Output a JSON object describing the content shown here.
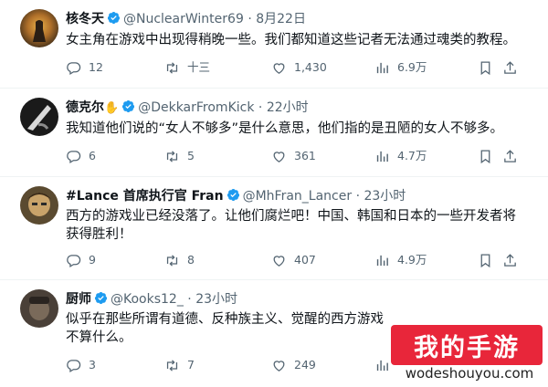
{
  "tweets": [
    {
      "name": "核冬天",
      "handle": "@NuclearWinter69",
      "sep": "·",
      "time": "8月22日",
      "text": "女主角在游戏中出现得稍晚一些。我们都知道这些记者无法通过魂类的教程。",
      "replies": "12",
      "retweets": "十三",
      "likes": "1,430",
      "views": "6.9万"
    },
    {
      "name": "德克尔",
      "handle": "@DekkarFromKick",
      "sep": "·",
      "time": "22小时",
      "text": "我知道他们说的“女人不够多”是什么意思，他们指的是丑陋的女人不够多。",
      "replies": "6",
      "retweets": "5",
      "likes": "361",
      "views": "4.7万"
    },
    {
      "name": "#Lance 首席执行官 Fran",
      "handle": "@MhFran_Lancer",
      "sep": "·",
      "time": "23小时",
      "text_line1": "西方的游戏业已经没落了。让他们腐烂吧！中国、韩国和日本的一些开发者将",
      "text_line2": "获得胜利！",
      "replies": "9",
      "retweets": "8",
      "likes": "407",
      "views": "4.9万"
    },
    {
      "name": "厨师",
      "handle": "@Kooks12_",
      "sep": "·",
      "time": "23小时",
      "text_line1": "似乎在那些所谓有道德、反种族主义、觉醒的西方游戏",
      "text_line2": "不算什么。",
      "replies": "3",
      "retweets": "7",
      "likes": "249",
      "views": ""
    }
  ],
  "watermark": {
    "title": "我的手游",
    "url": "wodeshouyou.com"
  },
  "colors": {
    "verified": "#1d9bf0",
    "icon": "#536471",
    "watermark_bg": "#e8263a"
  }
}
